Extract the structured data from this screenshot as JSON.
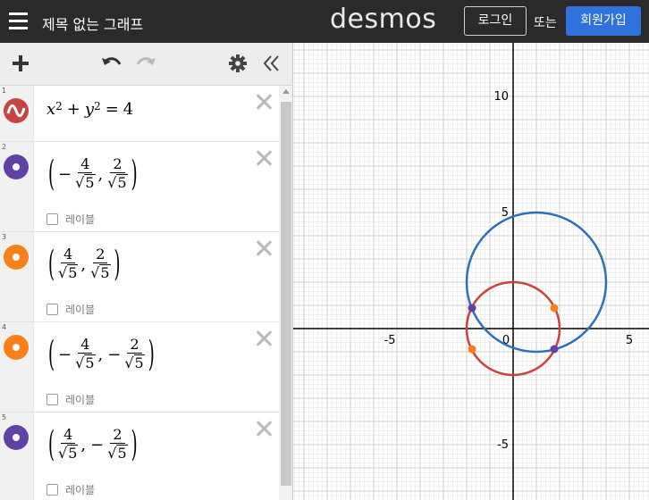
{
  "header": {
    "title": "제목 없는 그래프",
    "logo": "desmos",
    "login": "로그인",
    "or": "또는",
    "signup": "회원가입"
  },
  "toolbar": {
    "add": "add-icon",
    "undo": "undo-icon",
    "redo": "redo-icon",
    "settings": "gear-icon",
    "collapse": "double-chevron-left-icon"
  },
  "expressions": [
    {
      "index": "1",
      "latex": "x^2 + y^2 = 4",
      "color": "#c74440",
      "kind": "curve"
    },
    {
      "index": "2",
      "latex": "(-4/√5, 2/√5)",
      "color": "#6042a6",
      "kind": "point",
      "label": "레이블"
    },
    {
      "index": "3",
      "latex": "(4/√5, 2/√5)",
      "color": "#fa7e19",
      "kind": "point",
      "label": "레이블"
    },
    {
      "index": "4",
      "latex": "(-4/√5, -2/√5)",
      "color": "#fa7e19",
      "kind": "point",
      "label": "레이블"
    },
    {
      "index": "5",
      "latex": "(4/√5, -2/√5)",
      "color": "#6042a6",
      "kind": "point",
      "label": "레이블"
    }
  ],
  "math": {
    "sqrt_arg": "5",
    "n4": "4",
    "n2": "2",
    "minus": "−",
    "comma": ","
  },
  "graph": {
    "ticks_x": [
      "-5",
      "0",
      "5"
    ],
    "ticks_y": [
      "10",
      "5",
      "-5"
    ],
    "colors": {
      "red": "#c74440",
      "blue": "#2d70b3",
      "purple": "#6042a6",
      "orange": "#fa7e19"
    }
  }
}
